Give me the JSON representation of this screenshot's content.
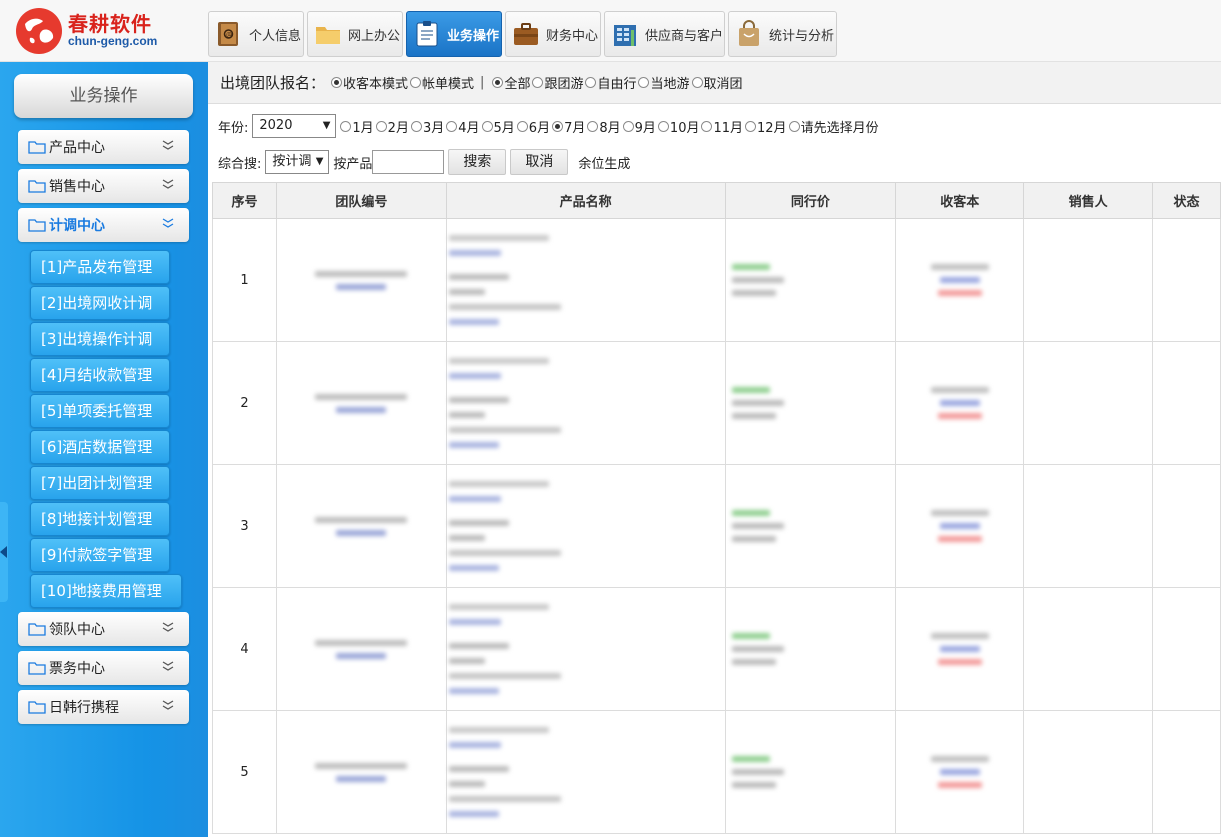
{
  "logo": {
    "brand": "春耕软件",
    "domain": "chun-geng.com"
  },
  "topnav": [
    {
      "label": "个人信息",
      "icon": "address-book-icon"
    },
    {
      "label": "网上办公",
      "icon": "folder-icon"
    },
    {
      "label": "业务操作",
      "icon": "clipboard-icon",
      "active": true
    },
    {
      "label": "财务中心",
      "icon": "briefcase-icon"
    },
    {
      "label": "供应商与客户",
      "icon": "building-icon"
    },
    {
      "label": "统计与分析",
      "icon": "shopping-bag-icon"
    }
  ],
  "sidebar": {
    "title": "业务操作",
    "categories": [
      {
        "label": "产品中心"
      },
      {
        "label": "销售中心"
      },
      {
        "label": "计调中心",
        "open": true
      },
      {
        "label": "领队中心"
      },
      {
        "label": "票务中心"
      },
      {
        "label": "日韩行携程"
      }
    ],
    "sub_items": [
      "[1]产品发布管理",
      "[2]出境网收计调",
      "[3]出境操作计调",
      "[4]月结收款管理",
      "[5]单项委托管理",
      "[6]酒店数据管理",
      "[7]出团计划管理",
      "[8]地接计划管理",
      "[9]付款签字管理",
      "[10]地接费用管理"
    ]
  },
  "filters": {
    "title": "出境团队报名：",
    "modes": [
      {
        "label": "收客本模式",
        "checked": true
      },
      {
        "label": "帐单模式",
        "checked": false
      }
    ],
    "separator": "|",
    "types": [
      {
        "label": "全部",
        "checked": true
      },
      {
        "label": "跟团游",
        "checked": false
      },
      {
        "label": "自由行",
        "checked": false
      },
      {
        "label": "当地游",
        "checked": false
      },
      {
        "label": "取消团",
        "checked": false
      }
    ],
    "year_label": "年份:",
    "year_value": "2020",
    "months": [
      {
        "label": "1月",
        "checked": false
      },
      {
        "label": "2月",
        "checked": false
      },
      {
        "label": "3月",
        "checked": false
      },
      {
        "label": "4月",
        "checked": false
      },
      {
        "label": "5月",
        "checked": false
      },
      {
        "label": "6月",
        "checked": false
      },
      {
        "label": "7月",
        "checked": true
      },
      {
        "label": "8月",
        "checked": false
      },
      {
        "label": "9月",
        "checked": false
      },
      {
        "label": "10月",
        "checked": false
      },
      {
        "label": "11月",
        "checked": false
      },
      {
        "label": "12月",
        "checked": false
      },
      {
        "label": "请先选择月份",
        "checked": false
      }
    ],
    "search_label": "综合搜:",
    "search_select": "按计调",
    "product_label": "按产品",
    "search_button": "搜索",
    "cancel_button": "取消",
    "remainder_text": "余位生成"
  },
  "table": {
    "columns": [
      "序号",
      "团队编号",
      "产品名称",
      "同行价",
      "收客本",
      "销售人",
      "状态"
    ],
    "rows": [
      {
        "index": "1"
      },
      {
        "index": "2"
      },
      {
        "index": "3"
      },
      {
        "index": "4"
      },
      {
        "index": "5"
      }
    ]
  },
  "colors": {
    "accent_blue": "#1a73c6",
    "sidebar_blue": "#1593e6",
    "brand_red": "#d9231c"
  }
}
